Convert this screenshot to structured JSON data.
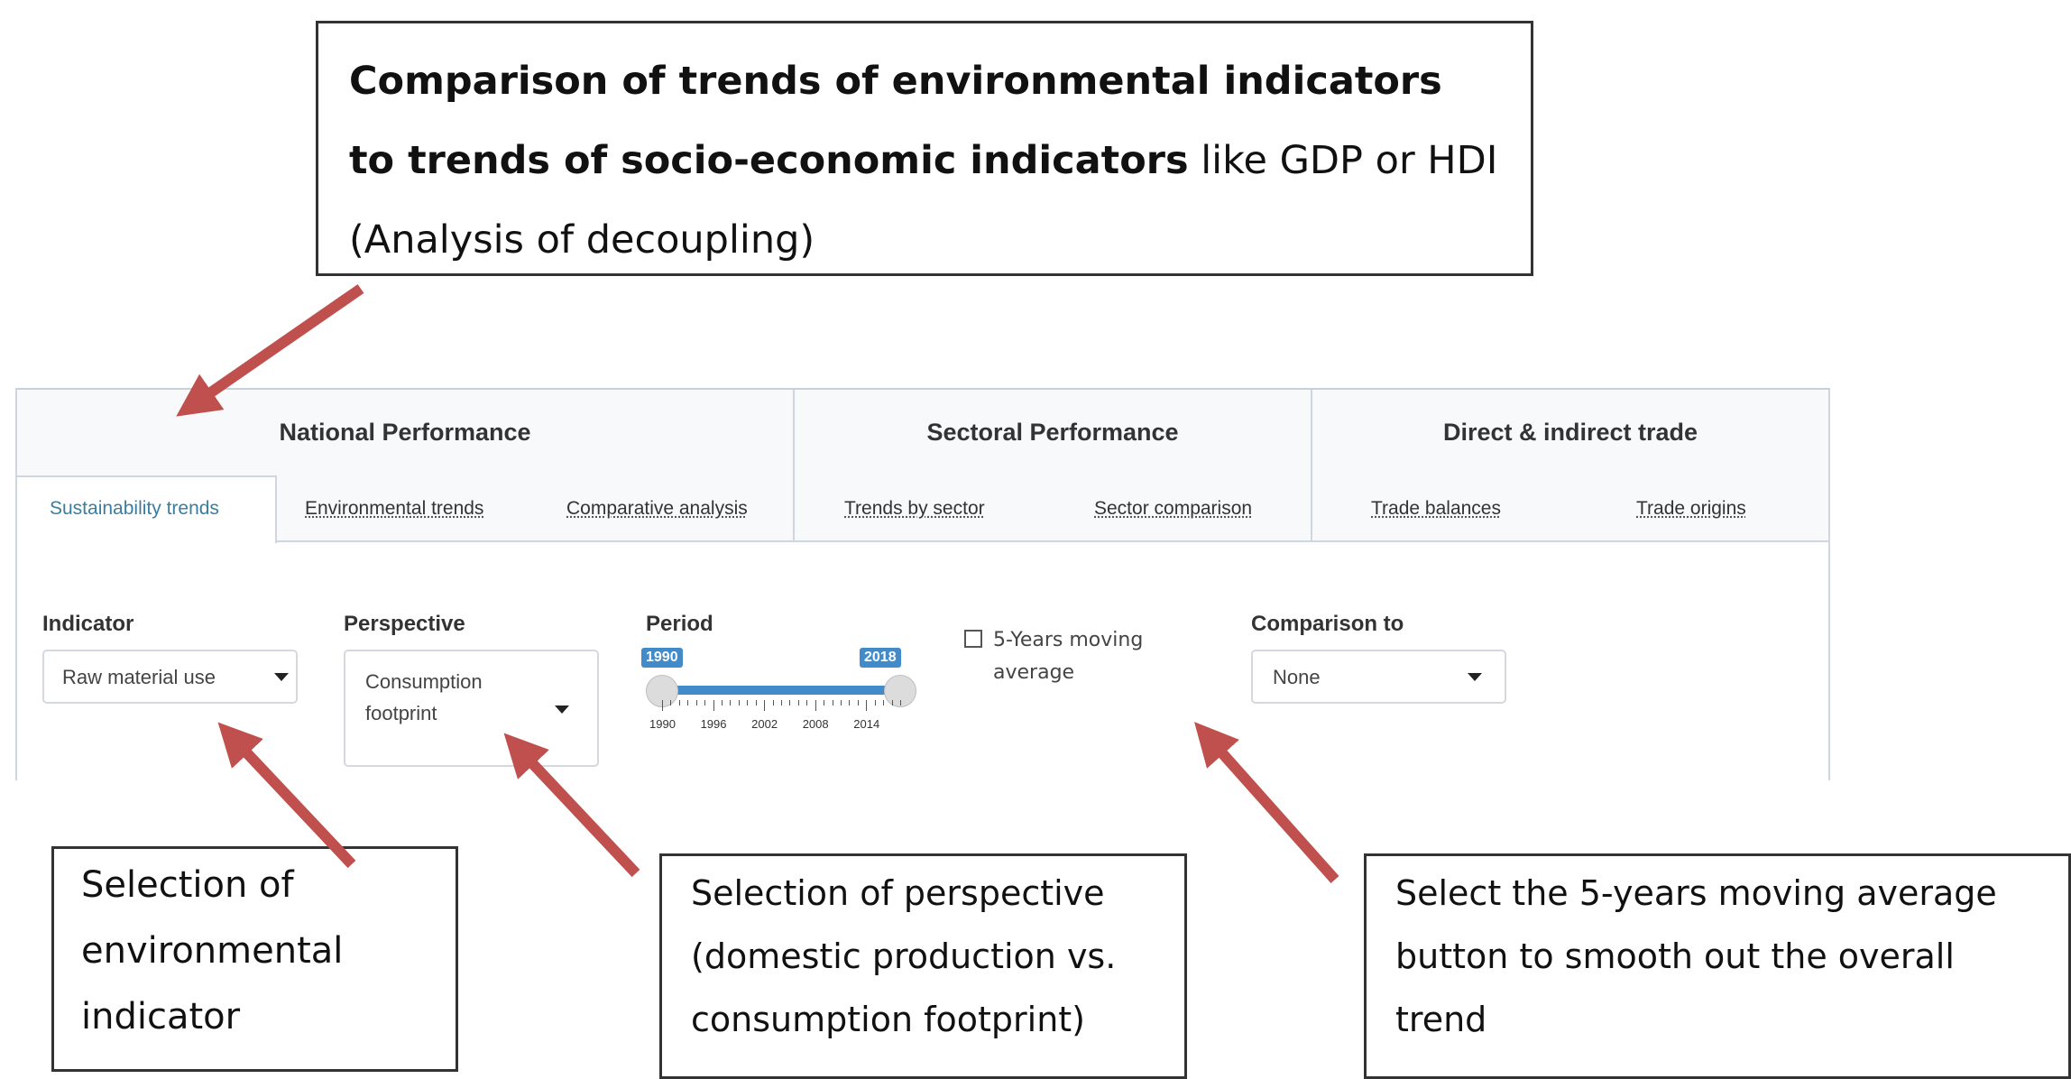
{
  "callouts": {
    "top_bold": "Comparison of trends of environmental indicators to trends of socio-economic indicators",
    "top_rest": " like GDP or HDI (Analysis of decoupling)",
    "indicator": "Selection of environmental indicator",
    "perspective": "Selection of perspective (domestic production vs. consumption footprint)",
    "moving_average": "Select the 5-years moving average button to smooth out the overall trend"
  },
  "nav": {
    "groups": [
      "National Performance",
      "Sectoral Performance",
      "Direct & indirect trade"
    ],
    "subtabs": [
      "Sustainability trends",
      "Environmental trends",
      "Comparative analysis",
      "Trends by sector",
      "Sector comparison",
      "Trade balances",
      "Trade origins"
    ],
    "active_subtab": "Sustainability trends"
  },
  "controls": {
    "indicator_label": "Indicator",
    "indicator_value": "Raw material use",
    "perspective_label": "Perspective",
    "perspective_value": "Consumption footprint",
    "period_label": "Period",
    "period_min": "1990",
    "period_max": "2018",
    "period_ticks": [
      "1990",
      "1996",
      "2002",
      "2008",
      "2014"
    ],
    "moving_average_label": "5-Years moving average",
    "moving_average_checked": false,
    "comparison_label": "Comparison to",
    "comparison_value": "None"
  },
  "colors": {
    "arrow": "#c0504d",
    "slider_accent": "#428bca",
    "active_tab_text": "#3a7d9e"
  }
}
